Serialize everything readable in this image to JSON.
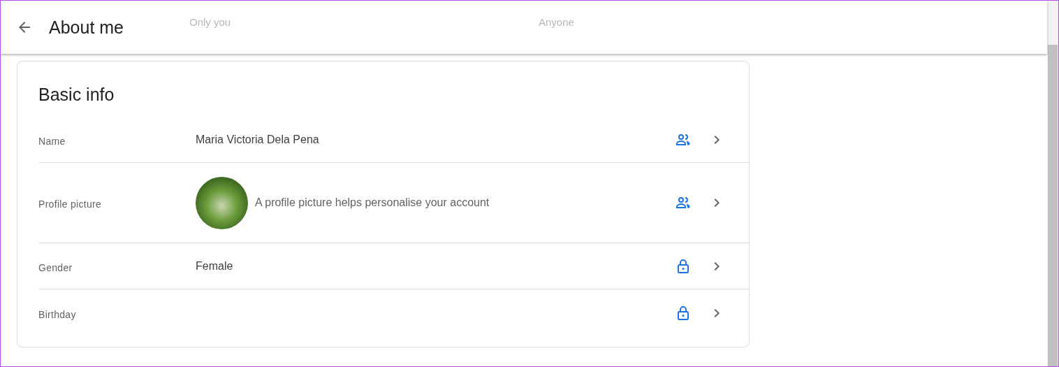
{
  "header": {
    "title": "About me",
    "faded_labels": [
      "Only you",
      "Anyone"
    ]
  },
  "card": {
    "title": "Basic info",
    "rows": [
      {
        "label": "Name",
        "kind": "text",
        "value": "Maria Victoria Dela Pena",
        "private": false
      },
      {
        "label": "Profile picture",
        "kind": "picture",
        "value": "A profile picture helps personalise your account",
        "private": false
      },
      {
        "label": "Gender",
        "kind": "text",
        "value": "Female",
        "private": true
      },
      {
        "label": "Birthday",
        "kind": "text",
        "private": true
      }
    ]
  }
}
